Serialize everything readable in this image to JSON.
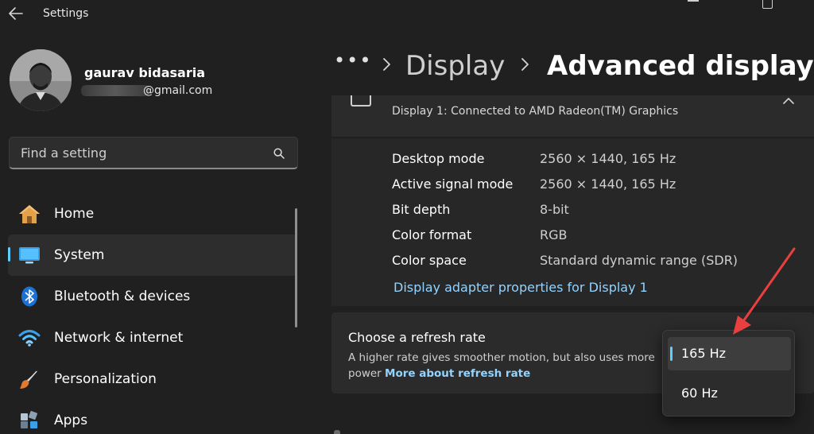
{
  "window": {
    "title": "Settings"
  },
  "profile": {
    "name": "gaurav bidasaria",
    "email_domain": "@gmail.com"
  },
  "search": {
    "placeholder": "Find a setting"
  },
  "sidebar": {
    "items": [
      {
        "label": "Home",
        "icon": "home-icon",
        "active": false
      },
      {
        "label": "System",
        "icon": "monitor-icon",
        "active": true
      },
      {
        "label": "Bluetooth & devices",
        "icon": "bluetooth-icon",
        "active": false
      },
      {
        "label": "Network & internet",
        "icon": "wifi-icon",
        "active": false
      },
      {
        "label": "Personalization",
        "icon": "brush-icon",
        "active": false
      },
      {
        "label": "Apps",
        "icon": "apps-icon",
        "active": false
      }
    ]
  },
  "breadcrumb": {
    "more": "•••",
    "parent": "Display",
    "current": "Advanced display"
  },
  "display_info": {
    "subtitle": "Display 1: Connected to AMD Radeon(TM) Graphics",
    "rows": [
      {
        "label": "Desktop mode",
        "value": "2560 × 1440, 165 Hz"
      },
      {
        "label": "Active signal mode",
        "value": "2560 × 1440, 165 Hz"
      },
      {
        "label": "Bit depth",
        "value": "8-bit"
      },
      {
        "label": "Color format",
        "value": "RGB"
      },
      {
        "label": "Color space",
        "value": "Standard dynamic range (SDR)"
      }
    ],
    "adapter_link": "Display adapter properties for Display 1"
  },
  "refresh": {
    "title": "Choose a refresh rate",
    "description": "A higher rate gives smoother motion, but also uses more power",
    "link": "More about refresh rate",
    "options": [
      "165 Hz",
      "60 Hz"
    ],
    "selected": "165 Hz"
  },
  "colors": {
    "accent": "#60cdff",
    "link": "#93d3ff",
    "annotation_arrow": "#e8403f"
  }
}
